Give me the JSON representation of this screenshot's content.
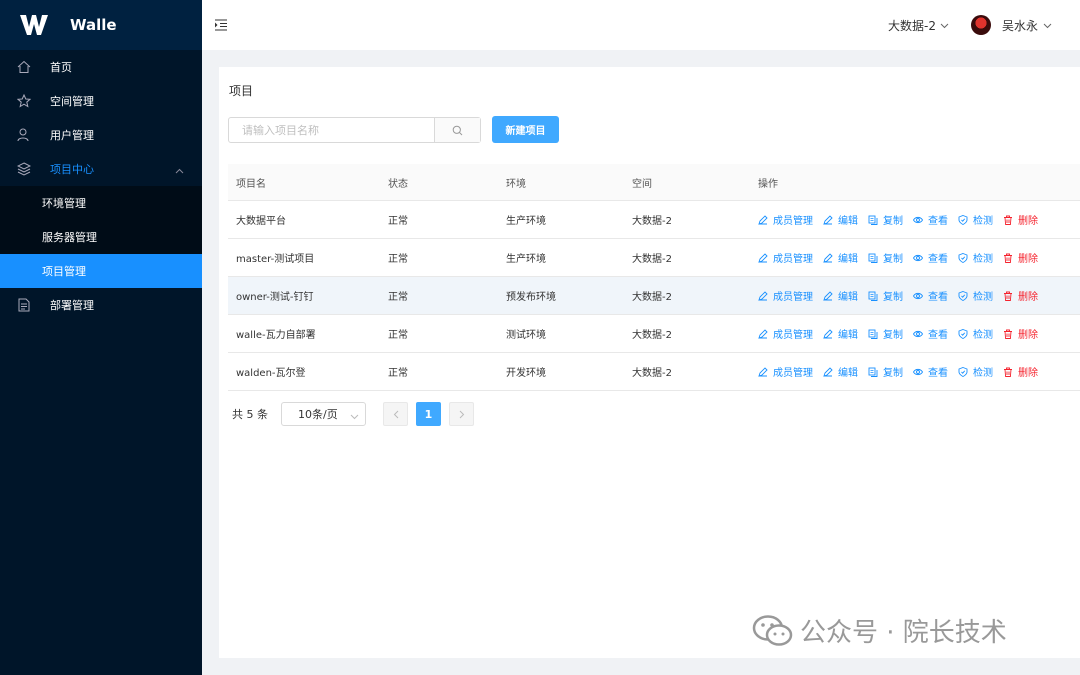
{
  "app": {
    "name": "Walle"
  },
  "sidebar": {
    "items": [
      {
        "label": "首页",
        "icon": "home-icon"
      },
      {
        "label": "空间管理",
        "icon": "star-icon"
      },
      {
        "label": "用户管理",
        "icon": "user-icon"
      },
      {
        "label": "项目中心",
        "icon": "layers-icon",
        "open": true
      },
      {
        "label": "部署管理",
        "icon": "deploy-doc-icon"
      }
    ],
    "sub": [
      {
        "label": "环境管理"
      },
      {
        "label": "服务器管理"
      },
      {
        "label": "项目管理",
        "active": true
      }
    ]
  },
  "header": {
    "space": "大数据-2",
    "user": "吴水永"
  },
  "main": {
    "title": "项目",
    "search": {
      "placeholder": "请输入项目名称",
      "value": ""
    },
    "new_button": "新建项目",
    "columns": [
      "项目名",
      "状态",
      "环境",
      "空间",
      "操作"
    ],
    "rows": [
      {
        "name": "大数据平台",
        "status": "正常",
        "env": "生产环境",
        "space": "大数据-2"
      },
      {
        "name": "master-测试项目",
        "status": "正常",
        "env": "生产环境",
        "space": "大数据-2"
      },
      {
        "name": "owner-测试-钉钉",
        "status": "正常",
        "env": "预发布环境",
        "space": "大数据-2"
      },
      {
        "name": "walle-瓦力自部署",
        "status": "正常",
        "env": "测试环境",
        "space": "大数据-2"
      },
      {
        "name": "walden-瓦尔登",
        "status": "正常",
        "env": "开发环境",
        "space": "大数据-2"
      }
    ],
    "actions": [
      "成员管理",
      "编辑",
      "复制",
      "查看",
      "检测",
      "删除"
    ],
    "pagination": {
      "total": "共 5 条",
      "page_size": "10条/页",
      "current": "1"
    }
  },
  "watermark": "公众号 · 院长技术",
  "colors": {
    "sidebar": "#001529",
    "primary": "#1890ff",
    "danger": "#f5222d"
  }
}
